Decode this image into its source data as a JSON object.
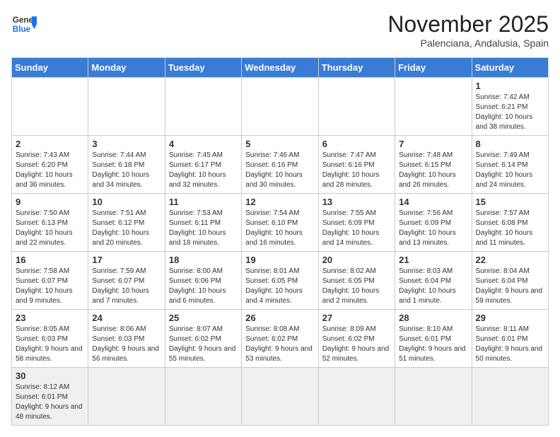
{
  "header": {
    "logo_general": "General",
    "logo_blue": "Blue",
    "month_year": "November 2025",
    "location": "Palenciana, Andalusia, Spain"
  },
  "weekdays": [
    "Sunday",
    "Monday",
    "Tuesday",
    "Wednesday",
    "Thursday",
    "Friday",
    "Saturday"
  ],
  "weeks": [
    [
      {
        "day": "",
        "info": ""
      },
      {
        "day": "",
        "info": ""
      },
      {
        "day": "",
        "info": ""
      },
      {
        "day": "",
        "info": ""
      },
      {
        "day": "",
        "info": ""
      },
      {
        "day": "",
        "info": ""
      },
      {
        "day": "1",
        "info": "Sunrise: 7:42 AM\nSunset: 6:21 PM\nDaylight: 10 hours and 38 minutes."
      }
    ],
    [
      {
        "day": "2",
        "info": "Sunrise: 7:43 AM\nSunset: 6:20 PM\nDaylight: 10 hours and 36 minutes."
      },
      {
        "day": "3",
        "info": "Sunrise: 7:44 AM\nSunset: 6:18 PM\nDaylight: 10 hours and 34 minutes."
      },
      {
        "day": "4",
        "info": "Sunrise: 7:45 AM\nSunset: 6:17 PM\nDaylight: 10 hours and 32 minutes."
      },
      {
        "day": "5",
        "info": "Sunrise: 7:46 AM\nSunset: 6:16 PM\nDaylight: 10 hours and 30 minutes."
      },
      {
        "day": "6",
        "info": "Sunrise: 7:47 AM\nSunset: 6:16 PM\nDaylight: 10 hours and 28 minutes."
      },
      {
        "day": "7",
        "info": "Sunrise: 7:48 AM\nSunset: 6:15 PM\nDaylight: 10 hours and 26 minutes."
      },
      {
        "day": "8",
        "info": "Sunrise: 7:49 AM\nSunset: 6:14 PM\nDaylight: 10 hours and 24 minutes."
      }
    ],
    [
      {
        "day": "9",
        "info": "Sunrise: 7:50 AM\nSunset: 6:13 PM\nDaylight: 10 hours and 22 minutes."
      },
      {
        "day": "10",
        "info": "Sunrise: 7:51 AM\nSunset: 6:12 PM\nDaylight: 10 hours and 20 minutes."
      },
      {
        "day": "11",
        "info": "Sunrise: 7:53 AM\nSunset: 6:11 PM\nDaylight: 10 hours and 18 minutes."
      },
      {
        "day": "12",
        "info": "Sunrise: 7:54 AM\nSunset: 6:10 PM\nDaylight: 10 hours and 16 minutes."
      },
      {
        "day": "13",
        "info": "Sunrise: 7:55 AM\nSunset: 6:09 PM\nDaylight: 10 hours and 14 minutes."
      },
      {
        "day": "14",
        "info": "Sunrise: 7:56 AM\nSunset: 6:09 PM\nDaylight: 10 hours and 13 minutes."
      },
      {
        "day": "15",
        "info": "Sunrise: 7:57 AM\nSunset: 6:08 PM\nDaylight: 10 hours and 11 minutes."
      }
    ],
    [
      {
        "day": "16",
        "info": "Sunrise: 7:58 AM\nSunset: 6:07 PM\nDaylight: 10 hours and 9 minutes."
      },
      {
        "day": "17",
        "info": "Sunrise: 7:59 AM\nSunset: 6:07 PM\nDaylight: 10 hours and 7 minutes."
      },
      {
        "day": "18",
        "info": "Sunrise: 8:00 AM\nSunset: 6:06 PM\nDaylight: 10 hours and 6 minutes."
      },
      {
        "day": "19",
        "info": "Sunrise: 8:01 AM\nSunset: 6:05 PM\nDaylight: 10 hours and 4 minutes."
      },
      {
        "day": "20",
        "info": "Sunrise: 8:02 AM\nSunset: 6:05 PM\nDaylight: 10 hours and 2 minutes."
      },
      {
        "day": "21",
        "info": "Sunrise: 8:03 AM\nSunset: 6:04 PM\nDaylight: 10 hours and 1 minute."
      },
      {
        "day": "22",
        "info": "Sunrise: 8:04 AM\nSunset: 6:04 PM\nDaylight: 9 hours and 59 minutes."
      }
    ],
    [
      {
        "day": "23",
        "info": "Sunrise: 8:05 AM\nSunset: 6:03 PM\nDaylight: 9 hours and 58 minutes."
      },
      {
        "day": "24",
        "info": "Sunrise: 8:06 AM\nSunset: 6:03 PM\nDaylight: 9 hours and 56 minutes."
      },
      {
        "day": "25",
        "info": "Sunrise: 8:07 AM\nSunset: 6:02 PM\nDaylight: 9 hours and 55 minutes."
      },
      {
        "day": "26",
        "info": "Sunrise: 8:08 AM\nSunset: 6:02 PM\nDaylight: 9 hours and 53 minutes."
      },
      {
        "day": "27",
        "info": "Sunrise: 8:09 AM\nSunset: 6:02 PM\nDaylight: 9 hours and 52 minutes."
      },
      {
        "day": "28",
        "info": "Sunrise: 8:10 AM\nSunset: 6:01 PM\nDaylight: 9 hours and 51 minutes."
      },
      {
        "day": "29",
        "info": "Sunrise: 8:11 AM\nSunset: 6:01 PM\nDaylight: 9 hours and 50 minutes."
      }
    ],
    [
      {
        "day": "30",
        "info": "Sunrise: 8:12 AM\nSunset: 6:01 PM\nDaylight: 9 hours and 48 minutes."
      },
      {
        "day": "",
        "info": ""
      },
      {
        "day": "",
        "info": ""
      },
      {
        "day": "",
        "info": ""
      },
      {
        "day": "",
        "info": ""
      },
      {
        "day": "",
        "info": ""
      },
      {
        "day": "",
        "info": ""
      }
    ]
  ]
}
